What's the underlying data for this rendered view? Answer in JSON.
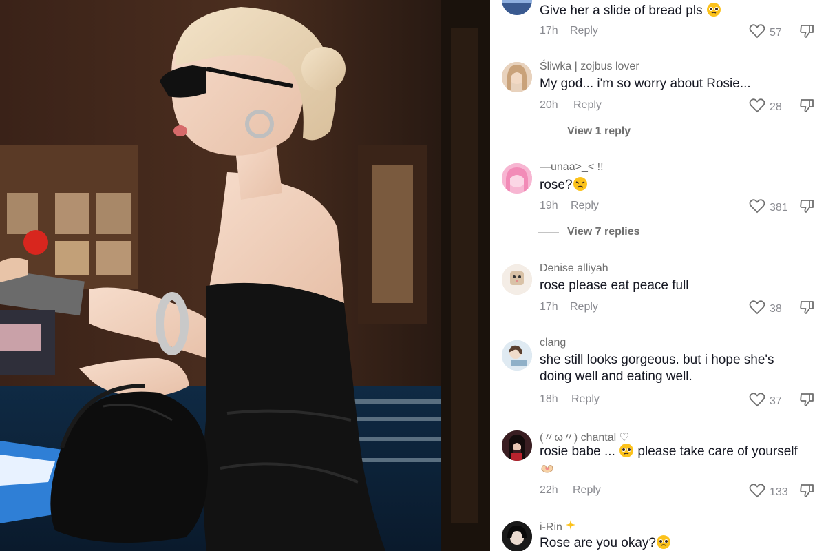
{
  "comments": [
    {
      "username": "",
      "text": "Give her a slide of bread pls",
      "emoji": "pleading-face",
      "time": "17h",
      "reply_label": "Reply",
      "likes": "57",
      "avatar_color": "#6d8fc4"
    },
    {
      "username": "Śliwka | zojbus lover",
      "text": "My god... i'm so worry about Rosie...",
      "time": "20h",
      "reply_label": "Reply",
      "likes": "28",
      "view_replies": "View 1 reply",
      "avatar_color": "#d9b89a"
    },
    {
      "username": "—unaa>_<  !!",
      "text": "rose?",
      "emoji": "persevering-face",
      "time": "19h",
      "reply_label": "Reply",
      "likes": "381",
      "view_replies": "View 7 replies",
      "avatar_color": "#f5a9c8"
    },
    {
      "username": "Denise alliyah",
      "text": "rose please eat peace full",
      "time": "17h",
      "reply_label": "Reply",
      "likes": "38",
      "avatar_color": "#e8d6c4"
    },
    {
      "username": "clang",
      "text_line1": "she still looks gorgeous. but i hope she's",
      "text_line2": "doing well and eating well.",
      "time": "18h",
      "reply_label": "Reply",
      "likes": "37",
      "avatar_color": "#b9cfe0"
    },
    {
      "username": "(〃ω〃) chantal ♡",
      "text_part1": "rosie babe ...",
      "text_part2": "please take care of yourself",
      "emoji": "pleading-face",
      "emoji2": "heart-hands",
      "time": "22h",
      "reply_label": "Reply",
      "likes": "133",
      "avatar_color": "#2b1c1c"
    },
    {
      "username": "i-Rin",
      "username_emoji": "sparkles",
      "text": "Rose are you okay?",
      "emoji": "pleading-face",
      "avatar_color": "#1a1a1a"
    }
  ],
  "colors": {
    "text_primary": "#161823",
    "text_secondary": "#8a8b91",
    "background": "#ffffff"
  },
  "icons": {
    "like": "heart-outline-icon",
    "dislike": "thumbs-down-outline-icon"
  }
}
